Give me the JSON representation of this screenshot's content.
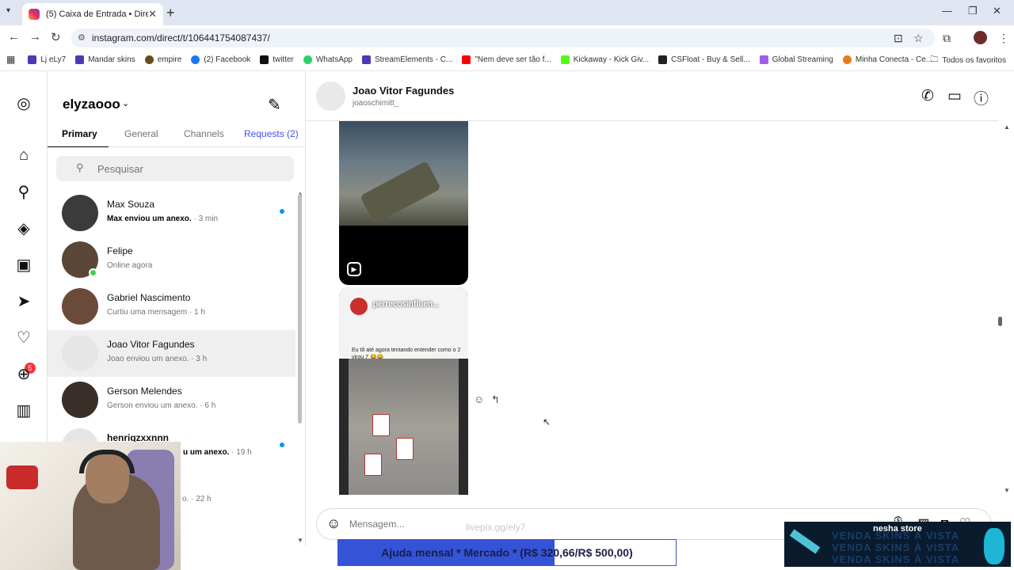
{
  "browser": {
    "tab_title": "(5) Caixa de Entrada • Direct",
    "url": "instagram.com/direct/t/106441754087437/",
    "new_tab": "+",
    "bookmarks": [
      {
        "label": "Lj eLy7",
        "color": "#4b3ab5"
      },
      {
        "label": "Mandar skins",
        "color": "#4b3ab5"
      },
      {
        "label": "empire",
        "color": "#6b4b1a"
      },
      {
        "label": "(2) Facebook",
        "color": "#1877f2"
      },
      {
        "label": "twitter",
        "color": "#111111"
      },
      {
        "label": "WhatsApp",
        "color": "#25d366"
      },
      {
        "label": "StreamElements - C...",
        "color": "#4b3ab5"
      },
      {
        "label": "\"Nem deve ser tão f...",
        "color": "#ff0000"
      },
      {
        "label": "Kickaway - Kick Giv...",
        "color": "#53fc18"
      },
      {
        "label": "CSFloat - Buy & Sell...",
        "color": "#222222"
      },
      {
        "label": "Global Streaming",
        "color": "#a45ce6"
      },
      {
        "label": "Minha Conecta - Ce...",
        "color": "#e57b1a"
      }
    ],
    "all_bookmarks": "Todos os favoritos"
  },
  "nav": {
    "badge": "5"
  },
  "inbox": {
    "username": "elyzaooo",
    "tabs": [
      "Primary",
      "General",
      "Channels",
      "Requests (2)"
    ],
    "search_placeholder": "Pesquisar",
    "conversations": [
      {
        "name": "Max Souza",
        "preview": "Max enviou um anexo.",
        "time": "· 3 min",
        "unread": true,
        "avatar": "#3b3b3b"
      },
      {
        "name": "Felipe",
        "preview": "Online agora",
        "time": "",
        "unread": false,
        "avatar": "#5a4636"
      },
      {
        "name": "Gabriel Nascimento",
        "preview": "Curtiu uma mensagem",
        "time": "· 1 h",
        "unread": false,
        "avatar": "#6b4a3a"
      },
      {
        "name": "Joao Vitor Fagundes",
        "preview": "Joao enviou um anexo.",
        "time": "· 3 h",
        "unread": false,
        "avatar": "#e6e6e6"
      },
      {
        "name": "Gerson Melendes",
        "preview": "Gerson enviou um anexo.",
        "time": "· 6 h",
        "unread": false,
        "avatar": "#3a2e28"
      },
      {
        "name": "henriqzxxnnn",
        "preview": "u um anexo.",
        "time": "· 19 h",
        "unread": true,
        "avatar": "#e6e6e6"
      },
      {
        "name": "",
        "preview": "o.",
        "time": "· 22 h",
        "unread": false,
        "avatar": "#d8d8d8"
      }
    ]
  },
  "chat": {
    "name": "Joao Vitor Fagundes",
    "handle": "joaoschimitt_",
    "reel_owner": "perrecosinfluen...",
    "reel_text": "Eu tô até agora tentando entender como o 2 virou 7 😂😂",
    "composer_placeholder": "Mensagem..."
  },
  "overlay": {
    "watermark": "livepix.gg/ely7",
    "goal_text": "Ajuda mensal * Mercado * (R$ 320,66/R$ 500,00)",
    "goal_current": 320.66,
    "goal_target": 500.0,
    "ad_brand": "nesha store",
    "ad_lines": [
      "VENDA SKINS À VISTA",
      "VENDA SKINS À VISTA",
      "VENDA SKINS À VISTA"
    ]
  }
}
